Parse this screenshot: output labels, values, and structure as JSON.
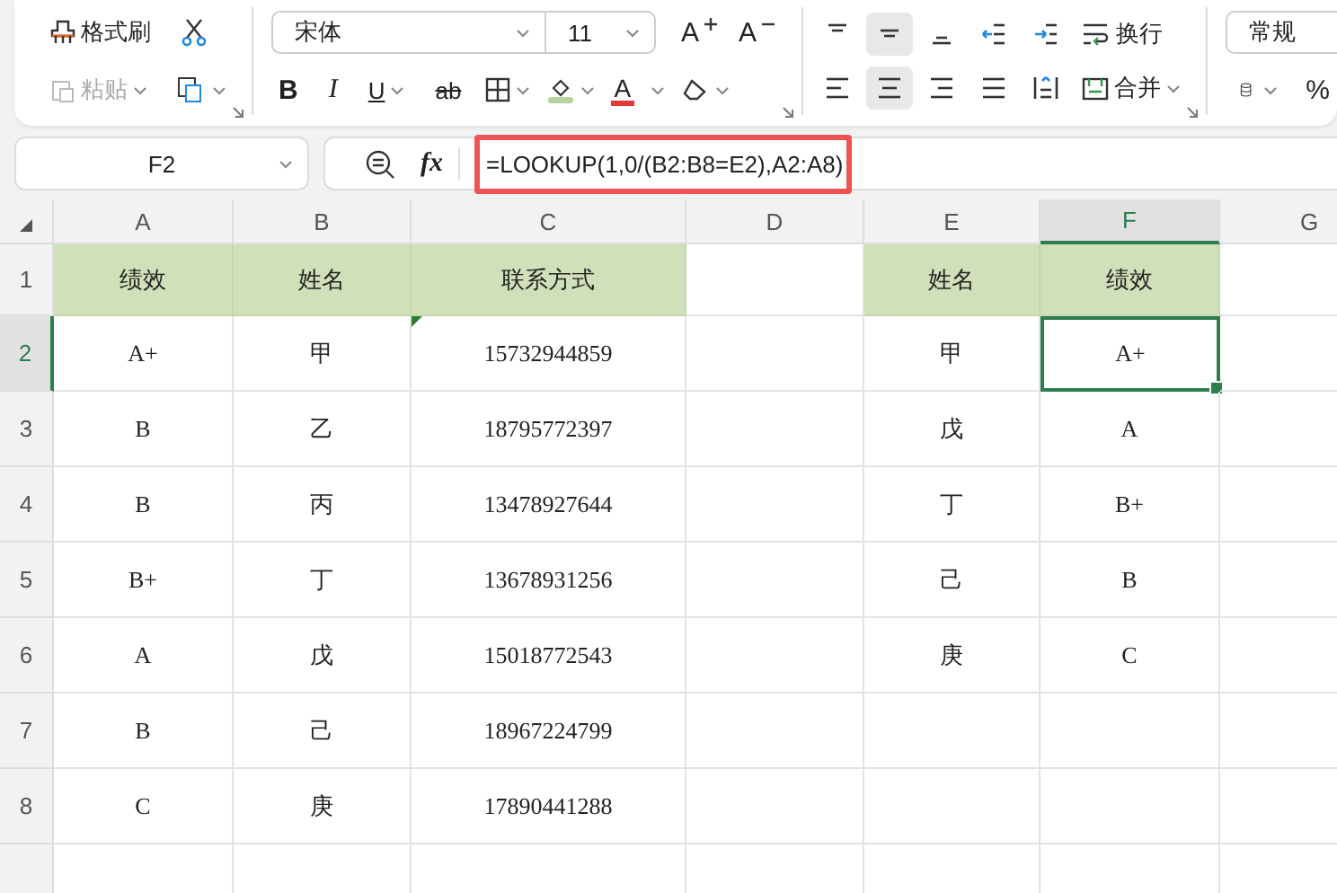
{
  "toolbar": {
    "format_painter": "格式刷",
    "paste": {
      "label": "粘贴",
      "disabled": true
    },
    "font": "宋体",
    "size": "11",
    "grow_font": "A",
    "shrink_font": "A",
    "bold": "B",
    "italic": "I",
    "underline": "U",
    "strike": "ab",
    "font_color": "A",
    "vertical_align": [
      {
        "kind": "top",
        "selected": false
      },
      {
        "kind": "middle",
        "selected": true
      },
      {
        "kind": "bottom",
        "selected": false
      },
      {
        "kind": "outdent",
        "selected": false
      },
      {
        "kind": "indent",
        "selected": false
      }
    ],
    "horizontal_align": [
      {
        "kind": "left",
        "selected": false
      },
      {
        "kind": "center",
        "selected": true
      },
      {
        "kind": "right",
        "selected": false
      },
      {
        "kind": "justify",
        "selected": false
      },
      {
        "kind": "distributed",
        "selected": false
      }
    ],
    "wrap": "换行",
    "merge": "合并",
    "number_format": "常规",
    "percent": "%"
  },
  "name_box": "F2",
  "fx": "fx",
  "formula": {
    "text": "=LOOKUP(1,0/(B2:B8=E2),A2:A8)",
    "highlighted": true
  },
  "columns": [
    {
      "label": "A",
      "selected": false
    },
    {
      "label": "B",
      "selected": false
    },
    {
      "label": "C",
      "selected": false
    },
    {
      "label": "D",
      "selected": false
    },
    {
      "label": "E",
      "selected": false
    },
    {
      "label": "F",
      "selected": true
    },
    {
      "label": "G",
      "selected": false
    }
  ],
  "rows": [
    {
      "header": "1",
      "selected": false,
      "cells": [
        {
          "text": "绩效",
          "kind": "header",
          "selected": false,
          "flagged": false
        },
        {
          "text": "姓名",
          "kind": "header",
          "selected": false,
          "flagged": false
        },
        {
          "text": "联系方式",
          "kind": "header",
          "selected": false,
          "flagged": false
        },
        {
          "kind": "blank",
          "selected": false,
          "flagged": false
        },
        {
          "text": "姓名",
          "kind": "header",
          "selected": false,
          "flagged": false
        },
        {
          "text": "绩效",
          "kind": "header",
          "selected": false,
          "flagged": false
        },
        {
          "kind": "blank",
          "selected": false,
          "flagged": false
        }
      ]
    },
    {
      "header": "2",
      "selected": true,
      "cells": [
        {
          "text": "A+",
          "kind": "value",
          "selected": false,
          "flagged": false
        },
        {
          "text": "甲",
          "kind": "value",
          "selected": false,
          "flagged": false
        },
        {
          "text": "15732944859",
          "kind": "value",
          "selected": false,
          "flagged": true
        },
        {
          "kind": "blank",
          "selected": false,
          "flagged": false
        },
        {
          "text": "甲",
          "kind": "value",
          "selected": false,
          "flagged": false
        },
        {
          "text": "A+",
          "kind": "value",
          "selected": true,
          "flagged": false
        },
        {
          "kind": "blank",
          "selected": false,
          "flagged": false
        }
      ]
    },
    {
      "header": "3",
      "selected": false,
      "cells": [
        {
          "text": "B",
          "kind": "value",
          "selected": false,
          "flagged": false
        },
        {
          "text": "乙",
          "kind": "value",
          "selected": false,
          "flagged": false
        },
        {
          "text": "18795772397",
          "kind": "value",
          "selected": false,
          "flagged": false
        },
        {
          "kind": "blank",
          "selected": false,
          "flagged": false
        },
        {
          "text": "戊",
          "kind": "value",
          "selected": false,
          "flagged": false
        },
        {
          "text": "A",
          "kind": "value",
          "selected": false,
          "flagged": false
        },
        {
          "kind": "blank",
          "selected": false,
          "flagged": false
        }
      ]
    },
    {
      "header": "4",
      "selected": false,
      "cells": [
        {
          "text": "B",
          "kind": "value",
          "selected": false,
          "flagged": false
        },
        {
          "text": "丙",
          "kind": "value",
          "selected": false,
          "flagged": false
        },
        {
          "text": "13478927644",
          "kind": "value",
          "selected": false,
          "flagged": false
        },
        {
          "kind": "blank",
          "selected": false,
          "flagged": false
        },
        {
          "text": "丁",
          "kind": "value",
          "selected": false,
          "flagged": false
        },
        {
          "text": "B+",
          "kind": "value",
          "selected": false,
          "flagged": false
        },
        {
          "kind": "blank",
          "selected": false,
          "flagged": false
        }
      ]
    },
    {
      "header": "5",
      "selected": false,
      "cells": [
        {
          "text": "B+",
          "kind": "value",
          "selected": false,
          "flagged": false
        },
        {
          "text": "丁",
          "kind": "value",
          "selected": false,
          "flagged": false
        },
        {
          "text": "13678931256",
          "kind": "value",
          "selected": false,
          "flagged": false
        },
        {
          "kind": "blank",
          "selected": false,
          "flagged": false
        },
        {
          "text": "己",
          "kind": "value",
          "selected": false,
          "flagged": false
        },
        {
          "text": "B",
          "kind": "value",
          "selected": false,
          "flagged": false
        },
        {
          "kind": "blank",
          "selected": false,
          "flagged": false
        }
      ]
    },
    {
      "header": "6",
      "selected": false,
      "cells": [
        {
          "text": "A",
          "kind": "value",
          "selected": false,
          "flagged": false
        },
        {
          "text": "戊",
          "kind": "value",
          "selected": false,
          "flagged": false
        },
        {
          "text": "15018772543",
          "kind": "value",
          "selected": false,
          "flagged": false
        },
        {
          "kind": "blank",
          "selected": false,
          "flagged": false
        },
        {
          "text": "庚",
          "kind": "value",
          "selected": false,
          "flagged": false
        },
        {
          "text": "C",
          "kind": "value",
          "selected": false,
          "flagged": false
        },
        {
          "kind": "blank",
          "selected": false,
          "flagged": false
        }
      ]
    },
    {
      "header": "7",
      "selected": false,
      "cells": [
        {
          "text": "B",
          "kind": "value",
          "selected": false,
          "flagged": false
        },
        {
          "text": "己",
          "kind": "value",
          "selected": false,
          "flagged": false
        },
        {
          "text": "18967224799",
          "kind": "value",
          "selected": false,
          "flagged": false
        },
        {
          "kind": "blank",
          "selected": false,
          "flagged": false
        },
        {
          "kind": "blank",
          "selected": false,
          "flagged": false
        },
        {
          "kind": "blank",
          "selected": false,
          "flagged": false
        },
        {
          "kind": "blank",
          "selected": false,
          "flagged": false
        }
      ]
    },
    {
      "header": "8",
      "selected": false,
      "cells": [
        {
          "text": "C",
          "kind": "value",
          "selected": false,
          "flagged": false
        },
        {
          "text": "庚",
          "kind": "value",
          "selected": false,
          "flagged": false
        },
        {
          "text": "17890441288",
          "kind": "value",
          "selected": false,
          "flagged": false
        },
        {
          "kind": "blank",
          "selected": false,
          "flagged": false
        },
        {
          "kind": "blank",
          "selected": false,
          "flagged": false
        },
        {
          "kind": "blank",
          "selected": false,
          "flagged": false
        },
        {
          "kind": "blank",
          "selected": false,
          "flagged": false
        }
      ]
    }
  ]
}
